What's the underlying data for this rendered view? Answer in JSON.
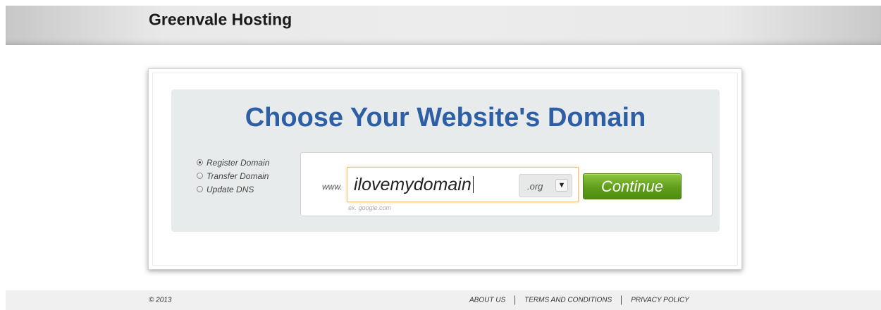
{
  "header": {
    "brand": "Greenvale Hosting"
  },
  "main": {
    "headline": "Choose Your Website's Domain",
    "options": [
      {
        "label": "Register Domain",
        "checked": true
      },
      {
        "label": "Transfer Domain",
        "checked": false
      },
      {
        "label": "Update DNS",
        "checked": false
      }
    ],
    "www_prefix": "www.",
    "domain_value": "ilovemydomain",
    "domain_hint": "ex. google.com",
    "tld_selected": ".org",
    "tld_arrow": "▼",
    "continue_label": "Continue"
  },
  "footer": {
    "copyright": "© 2013",
    "links": [
      "ABOUT US",
      "TERMS AND CONDITIONS",
      "PRIVACY POLICY"
    ]
  },
  "colors": {
    "headline": "#2e5fa5",
    "continue_button": "#5f9e1b",
    "input_focus": "#f0c67e"
  }
}
